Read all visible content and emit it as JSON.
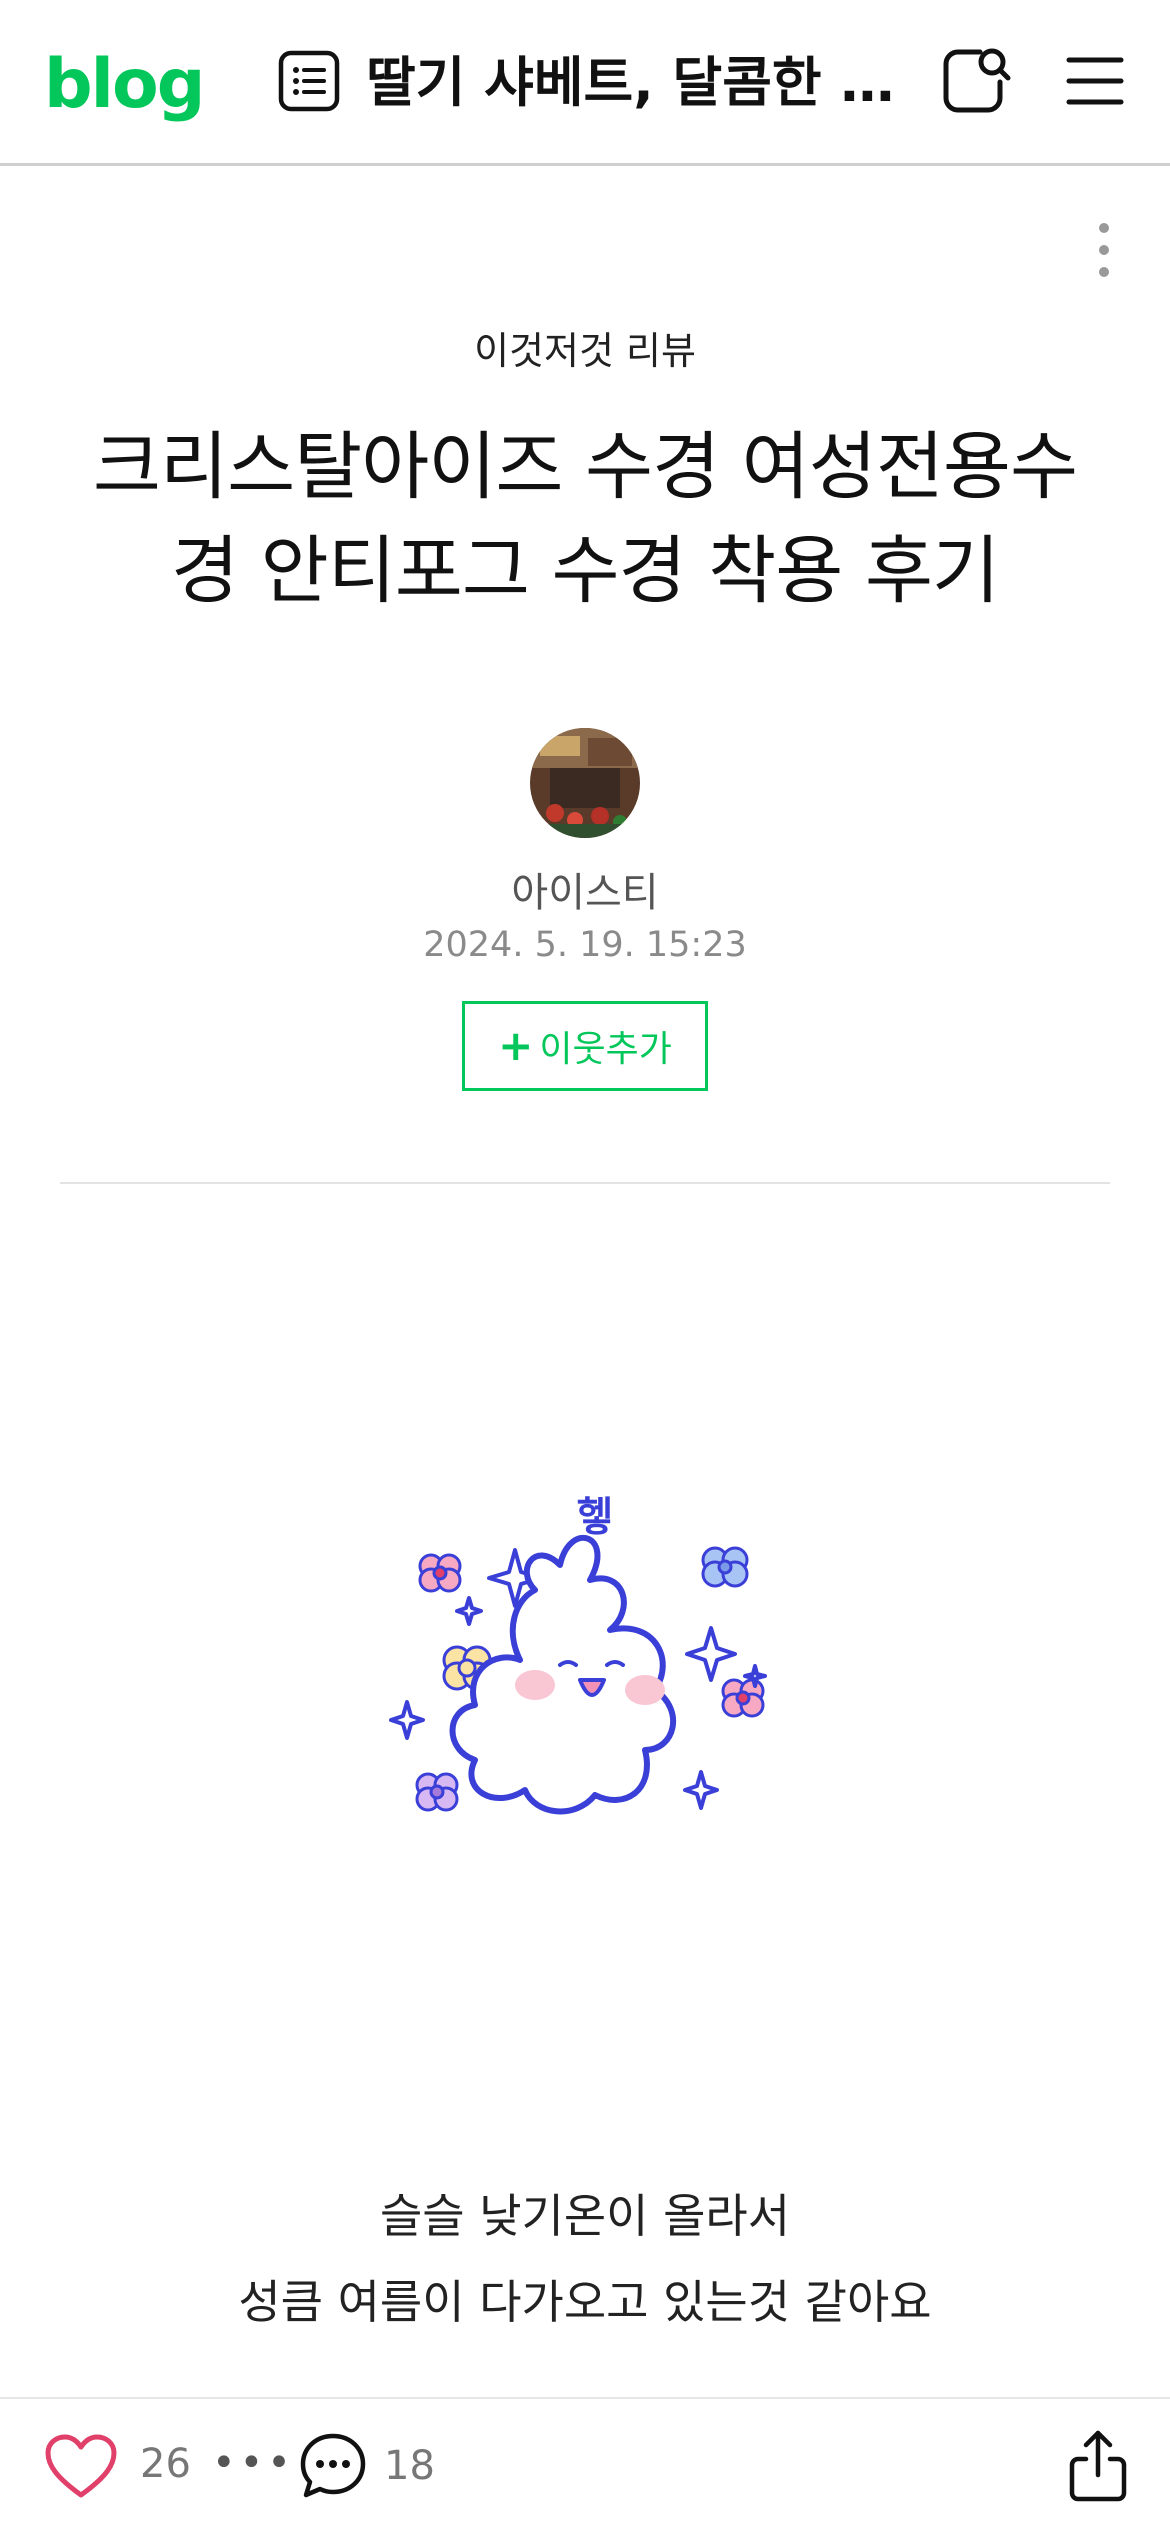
{
  "header": {
    "logo": "blog",
    "title": "딸기 샤베트, 달콤한 ...",
    "icons": [
      "list-icon",
      "search-icon",
      "menu-icon"
    ]
  },
  "post": {
    "category": "이것저것 리뷰",
    "title_line1": "크리스탈아이즈 수경 여성전용수",
    "title_line2": "경 안티포그 수경 착용 후기",
    "author": "아이스티",
    "date": "2024. 5. 19. 15:23",
    "follow_label": "이웃추가",
    "follow_plus": "+"
  },
  "sticker": {
    "text": "헿"
  },
  "body": {
    "line1": "슬슬 낮기온이 올라서",
    "line2": "성큼 여름이 다가오고 있는것 같아요"
  },
  "bottombar": {
    "like_count": "26",
    "more": "•••",
    "comment_count": "18"
  },
  "colors": {
    "brand": "#03c75a",
    "heart": "#e0406a",
    "sticker_line": "#3a3fd8"
  }
}
